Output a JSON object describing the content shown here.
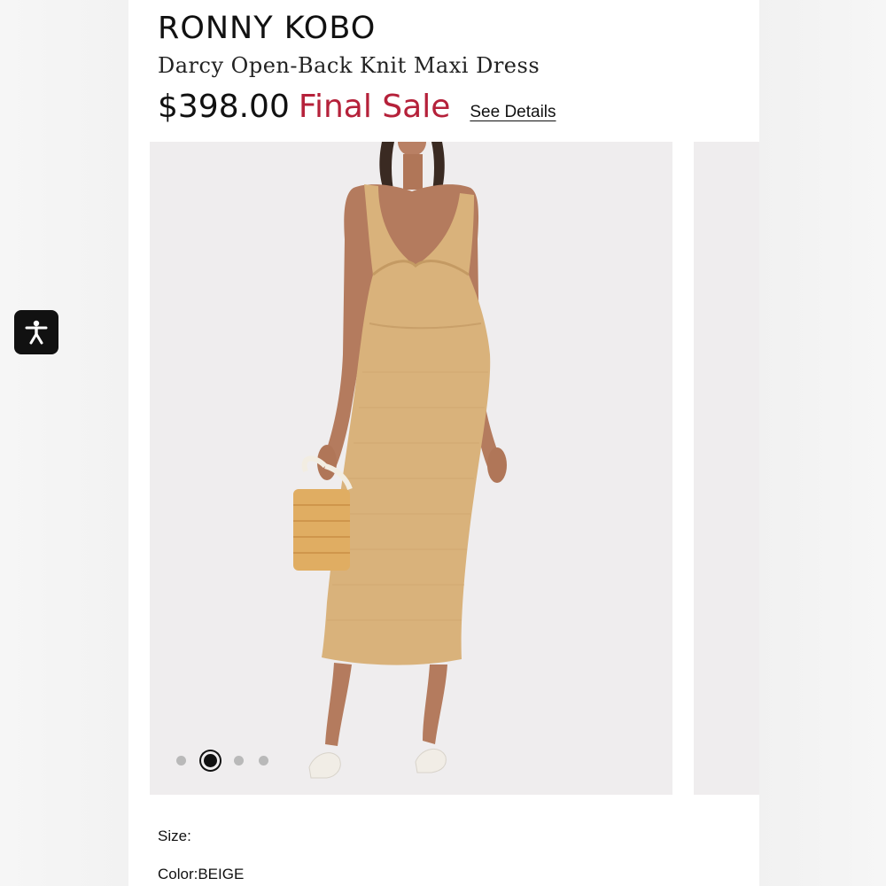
{
  "product": {
    "brand": "RONNY KOBO",
    "name": "Darcy Open-Back Knit Maxi Dress",
    "price": "$398.00",
    "sale_tag": "Final Sale",
    "details_link": "See Details"
  },
  "gallery": {
    "slide_count": 4,
    "active_slide_index": 1
  },
  "options": {
    "size_label": "Size:",
    "color_label": "Color:BEIGE"
  },
  "accessibility": {
    "icon": "accessibility-icon"
  },
  "colors": {
    "sale": "#b5213a",
    "text": "#111111",
    "dress": "#d9b27b",
    "image_bg": "#efedee"
  }
}
